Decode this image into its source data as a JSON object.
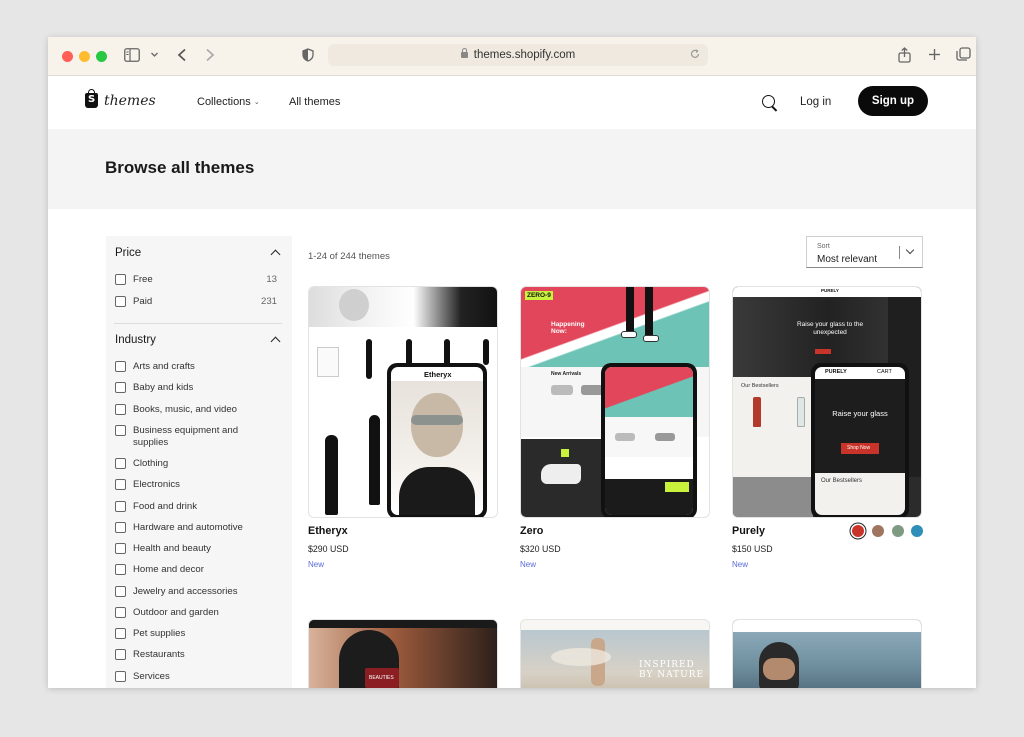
{
  "browser": {
    "url": "themes.shopify.com",
    "colors": {
      "close": "#ff5f57",
      "minimize": "#febc2e",
      "zoom": "#28c840"
    }
  },
  "header": {
    "logo_text": "themes",
    "nav": {
      "collections": "Collections",
      "all_themes": "All themes"
    },
    "login": "Log in",
    "signup": "Sign up"
  },
  "hero": {
    "title": "Browse all themes"
  },
  "filters": {
    "price": {
      "title": "Price",
      "items": [
        {
          "label": "Free",
          "count": "13"
        },
        {
          "label": "Paid",
          "count": "231"
        }
      ]
    },
    "industry": {
      "title": "Industry",
      "items": [
        {
          "label": "Arts and crafts"
        },
        {
          "label": "Baby and kids"
        },
        {
          "label": "Books, music, and video"
        },
        {
          "label": "Business equipment and supplies"
        },
        {
          "label": "Clothing"
        },
        {
          "label": "Electronics"
        },
        {
          "label": "Food and drink"
        },
        {
          "label": "Hardware and automotive"
        },
        {
          "label": "Health and beauty"
        },
        {
          "label": "Home and decor"
        },
        {
          "label": "Jewelry and accessories"
        },
        {
          "label": "Outdoor and garden"
        },
        {
          "label": "Pet supplies"
        },
        {
          "label": "Restaurants"
        },
        {
          "label": "Services"
        }
      ]
    }
  },
  "results": {
    "count_text": "1-24 of 244 themes",
    "sort": {
      "label": "Sort",
      "value": "Most relevant"
    }
  },
  "themes": [
    {
      "name": "Etheryx",
      "price": "$290 USD",
      "badge": "New",
      "preview": {
        "nav_label": "Etheryx"
      }
    },
    {
      "name": "Zero",
      "price": "$320 USD",
      "badge": "New",
      "preview": {
        "brand": "ZERO-9",
        "headline": "Happening Now:",
        "section": "New Arrivals"
      }
    },
    {
      "name": "Purely",
      "price": "$150 USD",
      "badge": "New",
      "swatches": [
        "#c8342a",
        "#a07560",
        "#7f9a83",
        "#2f8fb8"
      ],
      "preview": {
        "brand": "PURELY",
        "hero": "Raise your glass to the unexpected",
        "hero_mobile": "Raise your glass",
        "bestsellers": "Our Bestsellers",
        "cta": "Shop Now",
        "cart": "CART"
      }
    }
  ],
  "row2_previews": [
    {
      "label": "BEAUTIES"
    },
    {
      "label": "INSPIRED BY NATURE"
    },
    {
      "label": ""
    }
  ]
}
